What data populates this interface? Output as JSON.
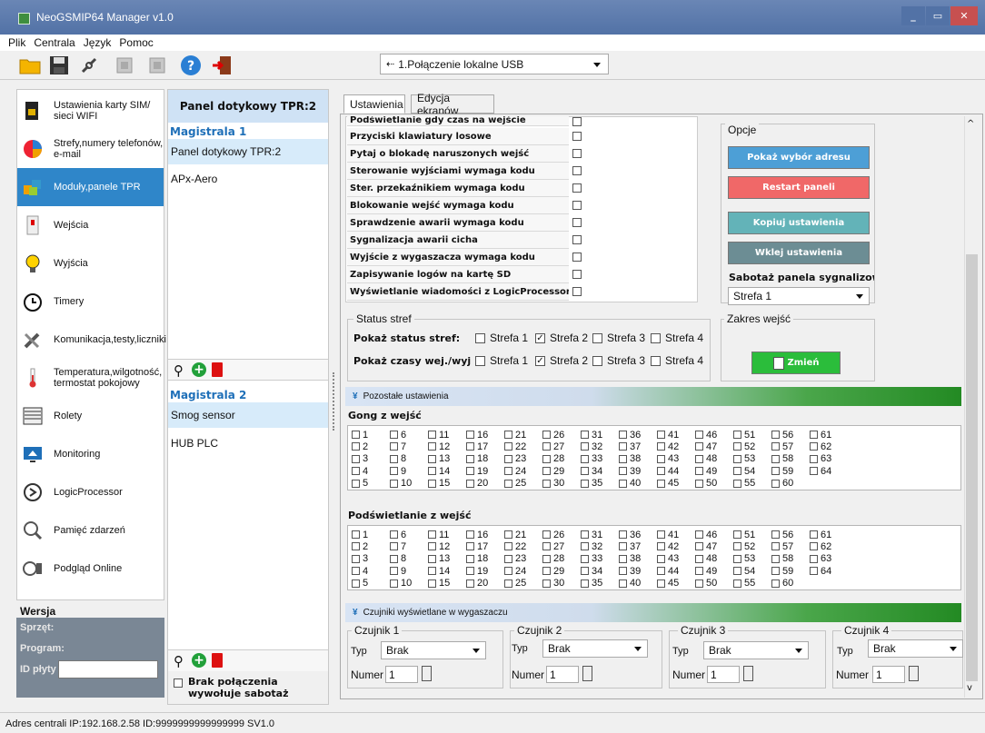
{
  "window": {
    "title": "NeoGSMIP64 Manager v1.0"
  },
  "menu": [
    "Plik",
    "Centrala",
    "Język",
    "Pomoc"
  ],
  "toolbar": {
    "connection": "1.Połączenie lokalne USB"
  },
  "sidebar": {
    "items": [
      {
        "label": "Ustawienia karty SIM/ sieci WIFI",
        "icon": "sim-card-icon"
      },
      {
        "label": "Strefy,numery telefonów, e-mail",
        "icon": "pie-chart-icon"
      },
      {
        "label": "Moduły,panele TPR",
        "icon": "modules-icon"
      },
      {
        "label": "Wejścia",
        "icon": "input-icon"
      },
      {
        "label": "Wyjścia",
        "icon": "bulb-icon"
      },
      {
        "label": "Timery",
        "icon": "clock-icon"
      },
      {
        "label": "Komunikacja,testy,liczniki",
        "icon": "tools-icon"
      },
      {
        "label": "Temperatura,wilgotność, termostat pokojowy",
        "icon": "thermometer-icon"
      },
      {
        "label": "Rolety",
        "icon": "blinds-icon"
      },
      {
        "label": "Monitoring",
        "icon": "monitor-icon"
      },
      {
        "label": "LogicProcessor",
        "icon": "logic-icon"
      },
      {
        "label": "Pamięć zdarzeń",
        "icon": "event-memory-icon"
      },
      {
        "label": "Podgląd Online",
        "icon": "online-preview-icon"
      }
    ],
    "active_index": 2,
    "version": {
      "title": "Wersja",
      "hw": "Sprzęt:",
      "prog": "Program:",
      "board_id": "ID płyty",
      "board_value": ""
    }
  },
  "panel": {
    "header": "Panel dotykowy TPR:2",
    "bus1": {
      "title": "Magistrala 1",
      "items": [
        "Panel dotykowy TPR:2",
        "APx-Aero"
      ]
    },
    "bus2": {
      "title": "Magistrala 2",
      "items": [
        "Smog sensor",
        "HUB PLC"
      ]
    },
    "no_conn_sabotage": "Brak połączenia wywołuje sabotaż"
  },
  "tabs": [
    "Ustawienia",
    "Edycja ekranów"
  ],
  "options": [
    {
      "label": "Podświetlanie gdy czas na wejście",
      "checked": false
    },
    {
      "label": "Przyciski klawiatury losowe",
      "checked": false
    },
    {
      "label": "Pytaj o blokadę naruszonych wejść",
      "checked": false
    },
    {
      "label": "Sterowanie wyjściami wymaga kodu",
      "checked": false
    },
    {
      "label": "Ster. przekaźnikiem wymaga kodu",
      "checked": false
    },
    {
      "label": "Blokowanie wejść wymaga kodu",
      "checked": false
    },
    {
      "label": "Sprawdzenie awarii wymaga kodu",
      "checked": false
    },
    {
      "label": "Sygnalizacja awarii cicha",
      "checked": false
    },
    {
      "label": "Wyjście z wygaszacza wymaga kodu",
      "checked": false
    },
    {
      "label": "Zapisywanie logów na kartę SD",
      "checked": false
    },
    {
      "label": "Wyświetlanie wiadomości z LogicProcessor",
      "checked": false
    }
  ],
  "opcje": {
    "title": "Opcje",
    "btn_addr": "Pokaż wybór adresu",
    "btn_restart": "Restart paneli",
    "btn_copy": "Kopiuj ustawienia",
    "btn_paste": "Wklej ustawienia",
    "sabotage_label": "Sabotaż panela sygnalizowany w",
    "sabotage_value": "Strefa 1"
  },
  "status": {
    "title": "Status stref",
    "row1_label": "Pokaż status stref:",
    "row2_label": "Pokaż czasy wej./wyj :",
    "zones": [
      "Strefa 1",
      "Strefa 2",
      "Strefa 3",
      "Strefa 4"
    ],
    "row1_checked": [
      false,
      true,
      false,
      false
    ],
    "row2_checked": [
      false,
      true,
      false,
      false
    ]
  },
  "zakres": {
    "title": "Zakres wejść",
    "button": "Zmień"
  },
  "pozostale": "Pozostałe ustawienia",
  "gong": {
    "title": "Gong z wejść"
  },
  "podswietlanie": {
    "title": "Podświetlanie z wejść"
  },
  "czujniki": {
    "title": "Czujniki wyświetlane w wygaszaczu",
    "type_label": "Typ",
    "number_label": "Numer",
    "sensors": [
      {
        "name": "Czujnik 1",
        "type": "Brak",
        "number": "1"
      },
      {
        "name": "Czujnik 2",
        "type": "Brak",
        "number": "1"
      },
      {
        "name": "Czujnik 3",
        "type": "Brak",
        "number": "1"
      },
      {
        "name": "Czujnik 4",
        "type": "Brak",
        "number": "1"
      }
    ]
  },
  "statusbar": {
    "text": "Adres centrali IP:192.168.2.58 ID:9999999999999999 SV1.0"
  }
}
